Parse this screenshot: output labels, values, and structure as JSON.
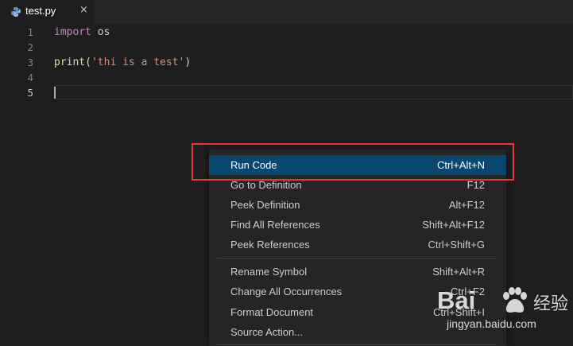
{
  "tab": {
    "filename": "test.py",
    "close_glyph": "×",
    "icon": "python-file-icon"
  },
  "editor": {
    "lines": [
      {
        "number": "1",
        "tokens": [
          {
            "text": "import",
            "color": "#c586c0"
          },
          {
            "text": " os",
            "color": "#d4d4d4"
          }
        ]
      },
      {
        "number": "2",
        "tokens": []
      },
      {
        "number": "3",
        "tokens": [
          {
            "text": "print",
            "color": "#dcdcaa"
          },
          {
            "text": "(",
            "color": "#d4d4d4"
          },
          {
            "text": "'thi is a test'",
            "color": "#ce9178"
          },
          {
            "text": ")",
            "color": "#d4d4d4"
          }
        ]
      },
      {
        "number": "4",
        "tokens": []
      },
      {
        "number": "5",
        "tokens": []
      }
    ],
    "active_line": "5"
  },
  "context_menu": {
    "items": [
      {
        "label": "Run Code",
        "shortcut": "Ctrl+Alt+N",
        "selected": true
      },
      {
        "label": "Go to Definition",
        "shortcut": "F12",
        "selected": false
      },
      {
        "label": "Peek Definition",
        "shortcut": "Alt+F12",
        "selected": false
      },
      {
        "label": "Find All References",
        "shortcut": "Shift+Alt+F12",
        "selected": false
      },
      {
        "label": "Peek References",
        "shortcut": "Ctrl+Shift+G",
        "selected": false
      },
      {
        "label": "Rename Symbol",
        "shortcut": "Shift+Alt+R",
        "selected": false
      },
      {
        "label": "Change All Occurrences",
        "shortcut": "Ctrl+F2",
        "selected": false
      },
      {
        "label": "Format Document",
        "shortcut": "Ctrl+Shift+I",
        "selected": false
      },
      {
        "label": "Source Action...",
        "shortcut": "",
        "selected": false
      }
    ]
  },
  "watermark": {
    "brand": "Bai",
    "chinese": "经验",
    "url": "jingyan.baidu.com"
  },
  "colors": {
    "editor_background": "#1e1e1e",
    "menu_background": "#252526",
    "menu_selected": "#094771",
    "highlight_border": "#e53935"
  }
}
